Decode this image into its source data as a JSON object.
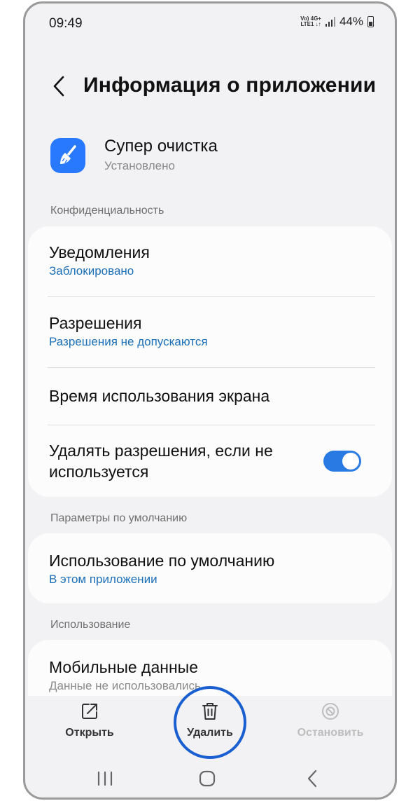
{
  "status_bar": {
    "time": "09:49",
    "network_line1": "Vo) 4G+",
    "network_line2": "LTE1 ↓↑",
    "battery": "44%"
  },
  "header": {
    "title": "Информация о приложении"
  },
  "app": {
    "name": "Супер очистка",
    "status": "Установлено",
    "icon_color": "#2979ff"
  },
  "privacy": {
    "label": "Конфиденциальность",
    "notifications": {
      "title": "Уведомления",
      "value": "Заблокировано"
    },
    "permissions": {
      "title": "Разрешения",
      "value": "Разрешения не допускаются"
    },
    "screen_time": {
      "title": "Время использования экрана"
    },
    "remove_permissions": {
      "title_line1": "Удалять разрешения, если не",
      "title_line2": "используется",
      "enabled": true
    }
  },
  "defaults": {
    "label": "Параметры по умолчанию",
    "default_use": {
      "title": "Использование по умолчанию",
      "value": "В этом приложении"
    }
  },
  "usage": {
    "label": "Использование",
    "mobile_data": {
      "title": "Мобильные данные",
      "value": "Данные не использовались"
    }
  },
  "actions": {
    "open": {
      "label": "Открыть",
      "icon": "open-external-icon"
    },
    "uninstall": {
      "label": "Удалить",
      "icon": "trash-icon"
    },
    "stop": {
      "label": "Остановить",
      "icon": "stop-icon",
      "disabled": true
    }
  },
  "colors": {
    "accent": "#2a7ae4",
    "link": "#1b6fb7",
    "highlight": "#1a5fd0"
  },
  "nav": {
    "recent": "recent-apps-icon",
    "home": "home-icon",
    "back": "back-icon"
  }
}
